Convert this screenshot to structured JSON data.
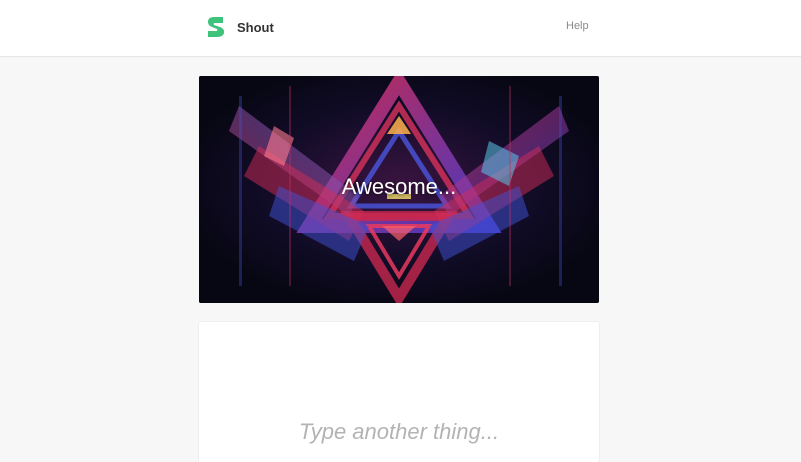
{
  "header": {
    "brand_name": "Shout",
    "help_label": "Help",
    "logo_icon": "s-logo-icon",
    "brand_color": "#3ec27c"
  },
  "hero": {
    "caption": "Awesome..."
  },
  "composer": {
    "placeholder": "Type another thing..."
  }
}
